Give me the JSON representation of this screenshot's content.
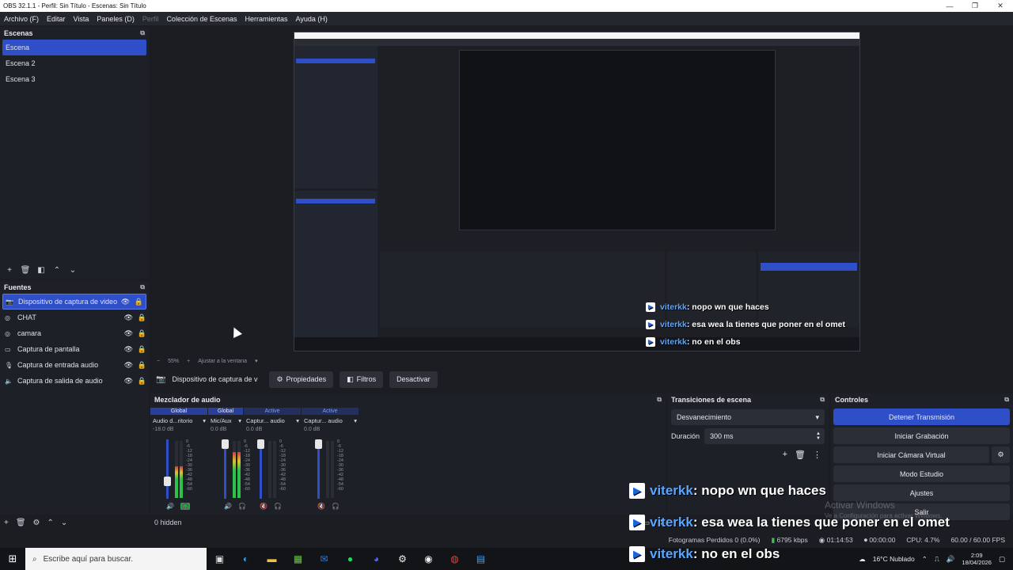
{
  "window": {
    "title": "OBS 32.1.1 - Perfil: Sin Título - Escenas: Sin Título",
    "controls": [
      "—",
      "❐",
      "✕"
    ]
  },
  "menu": [
    {
      "label": "Archivo (F)"
    },
    {
      "label": "Editar"
    },
    {
      "label": "Vista"
    },
    {
      "label": "Paneles (D)"
    },
    {
      "label": "Perfil"
    },
    {
      "label": "Colección de Escenas"
    },
    {
      "label": "Herramientas"
    },
    {
      "label": "Ayuda (H)"
    }
  ],
  "scenes": {
    "title": "Escenas",
    "items": [
      "Escena",
      "Escena 2",
      "Escena 3"
    ],
    "selected": "Escena"
  },
  "sources": {
    "title": "Fuentes",
    "items": [
      {
        "label": "Dispositivo de captura de video",
        "icon": "camera-icon"
      },
      {
        "label": "CHAT",
        "icon": "browser-icon"
      },
      {
        "label": "camara",
        "icon": "browser-icon"
      },
      {
        "label": "Captura de pantalla",
        "icon": "monitor-icon"
      },
      {
        "label": "Captura de entrada audio",
        "icon": "microphone-icon"
      },
      {
        "label": "Captura de salida de audio",
        "icon": "speaker-icon"
      }
    ]
  },
  "zoom": {
    "value": "55%",
    "fit_label": "Ajustar a la ventana"
  },
  "source_toolbar": {
    "selected": "Dispositivo de captura de v",
    "properties": "Propiedades",
    "filters": "Filtros",
    "deactivate": "Desactivar"
  },
  "mixer": {
    "title": "Mezclador de audio",
    "hidden_label": "0 hidden",
    "channels": [
      {
        "status": "Global",
        "name": "Audio d...ritorio",
        "db": "-18.0 dB",
        "volume": 0.25,
        "level": 0.55,
        "muted": false
      },
      {
        "status": "Global",
        "name": "Mic/Aux",
        "db": "0.0 dB",
        "volume": 1.0,
        "level": 0.8,
        "muted": false
      },
      {
        "status": "Active",
        "name": "Captur... audio",
        "db": "0.0 dB",
        "volume": 1.0,
        "level": 0.0,
        "muted": true
      },
      {
        "status": "Active",
        "name": "Captur... audio",
        "db": "0.0 dB",
        "volume": 1.0,
        "level": 0.0,
        "muted": true
      }
    ],
    "scale": [
      "0",
      "-6",
      "-12",
      "-18",
      "-24",
      "-30",
      "-36",
      "-42",
      "-48",
      "-54",
      "-60"
    ]
  },
  "transitions": {
    "title": "Transiciones de escena",
    "selected": "Desvanecimiento",
    "duration_label": "Duración",
    "duration_value": "300 ms"
  },
  "controls": {
    "title": "Controles",
    "stop_stream": "Detener Transmisión",
    "start_recording": "Iniciar Grabación",
    "start_virtual_cam": "Iniciar Cámara Virtual",
    "studio_mode": "Modo Estudio",
    "settings": "Ajustes",
    "exit": "Salir"
  },
  "status": {
    "dropped_frames": "Fotogramas Perdidos 0 (0.0%)",
    "bitrate": "6795 kbps",
    "stream_time": "01:14:53",
    "rec_time": "00:00:00",
    "cpu": "CPU: 4.7%",
    "fps": "60.00 / 60.00 FPS"
  },
  "taskbar": {
    "search_placeholder": "Escribe aquí para buscar.",
    "weather": "16°C  Nublado",
    "time": "2:09",
    "date": "18/04/2026"
  },
  "chat": [
    {
      "user": "viterkk",
      "message": ": nopo wn que haces"
    },
    {
      "user": "viterkk",
      "message": ": esa wea la tienes que poner en el omet"
    },
    {
      "user": "viterkk",
      "message": ": no en el obs"
    }
  ],
  "watermark": {
    "line1": "Activar Windows",
    "line2": "Ve a Configuración para activar Windows."
  },
  "colors": {
    "accent": "#2f4fc9",
    "panel": "#1e2027",
    "background": "#1b1d23",
    "twitch_user": "#5aa6ff"
  }
}
